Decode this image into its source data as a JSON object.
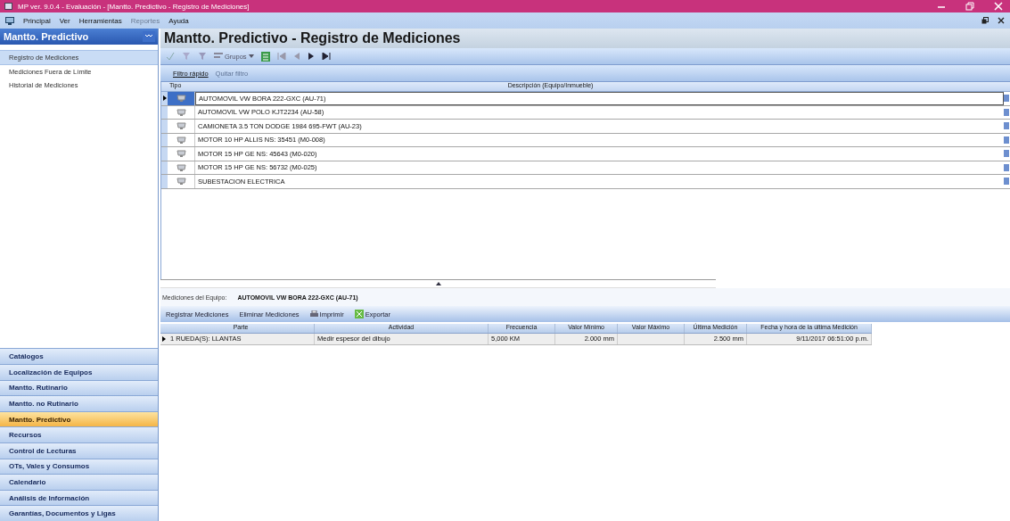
{
  "window": {
    "title": "MP ver. 9.0.4 - Evaluación - [Mantto. Predictivo - Registro de Mediciones]"
  },
  "menu": [
    {
      "label": "Principal",
      "disabled": false
    },
    {
      "label": "Ver",
      "disabled": false
    },
    {
      "label": "Herramientas",
      "disabled": false
    },
    {
      "label": "Reportes",
      "disabled": true
    },
    {
      "label": "Ayuda",
      "disabled": false
    }
  ],
  "sidebar": {
    "title": "Mantto. Predictivo",
    "items": [
      {
        "label": "Registro de Mediciones",
        "selected": true
      },
      {
        "label": "Mediciones Fuera de Límite",
        "selected": false
      },
      {
        "label": "Historial de Mediciones",
        "selected": false
      }
    ],
    "sections": [
      {
        "label": "Catálogos",
        "selected": false
      },
      {
        "label": "Localización de Equipos",
        "selected": false
      },
      {
        "label": "Mantto. Rutinario",
        "selected": false
      },
      {
        "label": "Mantto. no Rutinario",
        "selected": false
      },
      {
        "label": "Mantto. Predictivo",
        "selected": true
      },
      {
        "label": "Recursos",
        "selected": false
      },
      {
        "label": "Control de Lecturas",
        "selected": false
      },
      {
        "label": "OTs, Vales y Consumos",
        "selected": false
      },
      {
        "label": "Calendario",
        "selected": false
      },
      {
        "label": "Análisis de Información",
        "selected": false
      },
      {
        "label": "Garantías, Documentos y Ligas",
        "selected": false
      }
    ]
  },
  "page_title": "Mantto. Predictivo - Registro de Mediciones",
  "toolbar": {
    "groups_button": "Grupos"
  },
  "filter_bar": [
    {
      "label": "Filtro rápido",
      "disabled": false
    },
    {
      "label": "Quitar filtro",
      "disabled": true
    }
  ],
  "equipment_table": {
    "columns": [
      "Tipo",
      "Descripción (Equipo/Inmueble)"
    ],
    "rows": [
      {
        "description": "AUTOMOVIL VW BORA 222-GXC (AU-71)",
        "selected": true
      },
      {
        "description": "AUTOMOVIL VW POLO KJT2234 (AU-58)",
        "selected": false
      },
      {
        "description": "CAMIONETA 3.5 TON DODGE 1984 695-FWT (AU-23)",
        "selected": false
      },
      {
        "description": "MOTOR 10 HP ALLIS NS: 35451 (M0-008)",
        "selected": false
      },
      {
        "description": "MOTOR 15 HP GE NS: 45643 (M0-020)",
        "selected": false
      },
      {
        "description": "MOTOR 15 HP GE NS: 56732 (M0-025)",
        "selected": false
      },
      {
        "description": "SUBESTACION ELECTRICA",
        "selected": false
      }
    ]
  },
  "measurements": {
    "label": "Mediciones del Equipo:",
    "equipment": "AUTOMOVIL VW BORA 222-GXC (AU-71)",
    "actions": [
      "Registrar Mediciones",
      "Eliminar Mediciones",
      "Imprimir",
      "Exportar"
    ],
    "columns": [
      "Parte",
      "Actividad",
      "Frecuencia",
      "Valor Mínimo",
      "Valor Máximo",
      "Última Medición",
      "Fecha y hora de la última Medición"
    ],
    "rows": [
      {
        "cells": [
          "1 RUEDA(S): LLANTAS",
          "Medir espesor del dibujo",
          "5,000 KM",
          "2.000 mm",
          "",
          "2.500 mm",
          "9/11/2017 06:51:00 p.m."
        ],
        "selected": true
      }
    ]
  }
}
